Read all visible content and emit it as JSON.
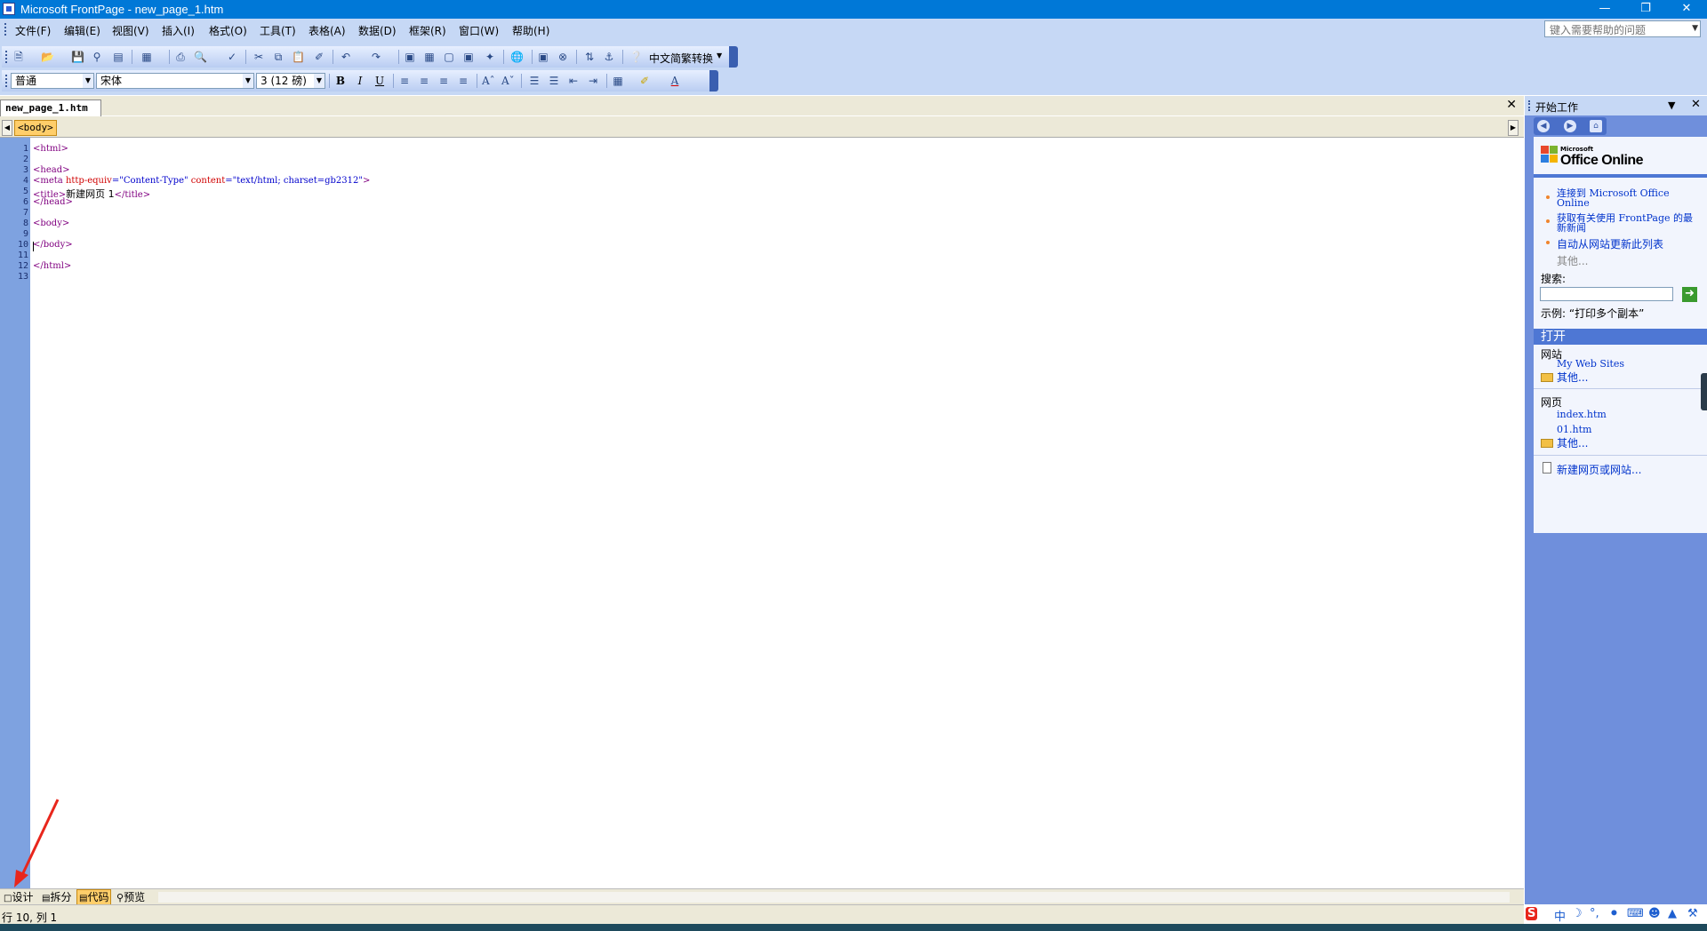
{
  "window": {
    "title": "Microsoft FrontPage - new_page_1.htm"
  },
  "menu": [
    "文件(F)",
    "编辑(E)",
    "视图(V)",
    "插入(I)",
    "格式(O)",
    "工具(T)",
    "表格(A)",
    "数据(D)",
    "框架(R)",
    "窗口(W)",
    "帮助(H)"
  ],
  "help": {
    "placeholder": "键入需要帮助的问题"
  },
  "toolbar": {
    "convert_label": "中文简繁转换"
  },
  "format_bar": {
    "style": "普通",
    "font": "宋体",
    "size": "3 (12 磅)"
  },
  "doc": {
    "tab": "new_page_1.htm",
    "tag": "<body>"
  },
  "code_lines": {
    "l1": "<html>",
    "l3": "<head>",
    "l4_tag": "<meta ",
    "l4_attr1": "http-equiv",
    "l4_eq1": "=",
    "l4_val1": "\"Content-Type\"",
    "l4_attr2": "content",
    "l4_eq2": "=",
    "l4_val2": "\"text/html; charset=gb2312\"",
    "l4_end": ">",
    "l5_open": "<title>",
    "l5_text": "新建网页 1",
    "l5_close": "</title>",
    "l6": "</head>",
    "l8": "<body>",
    "l10": "</body>",
    "l12": "</html>"
  },
  "line_numbers": [
    "1",
    "2",
    "3",
    "4",
    "5",
    "6",
    "7",
    "8",
    "9",
    "10",
    "11",
    "12",
    "13"
  ],
  "view_tabs": {
    "design": "设计",
    "split": "拆分",
    "code": "代码",
    "preview": "预览"
  },
  "status": {
    "position": "行 10, 列 1"
  },
  "task_pane": {
    "title": "开始工作",
    "logo_text": "Office Online",
    "logo_small": "Microsoft",
    "links": [
      "连接到 Microsoft Office Online",
      "获取有关使用 FrontPage 的最新新闻",
      "自动从网站更新此列表"
    ],
    "more": "其他...",
    "search_label": "搜索:",
    "example": "示例: “打印多个副本”",
    "open_title": "打开",
    "sites_label": "网站",
    "sites": [
      "My Web Sites"
    ],
    "sites_more": "其他...",
    "pages_label": "网页",
    "pages": [
      "index.htm",
      "01.htm"
    ],
    "pages_more": "其他...",
    "new_link": "新建网页或网站..."
  },
  "tray": {
    "ime": "中"
  },
  "colors": {
    "titlebar": "#0078d7",
    "menubar": "#c6d8f5",
    "gutter": "#7ea2e0",
    "pane": "#6f8fdc",
    "accent_tag": "#ffce6a"
  }
}
